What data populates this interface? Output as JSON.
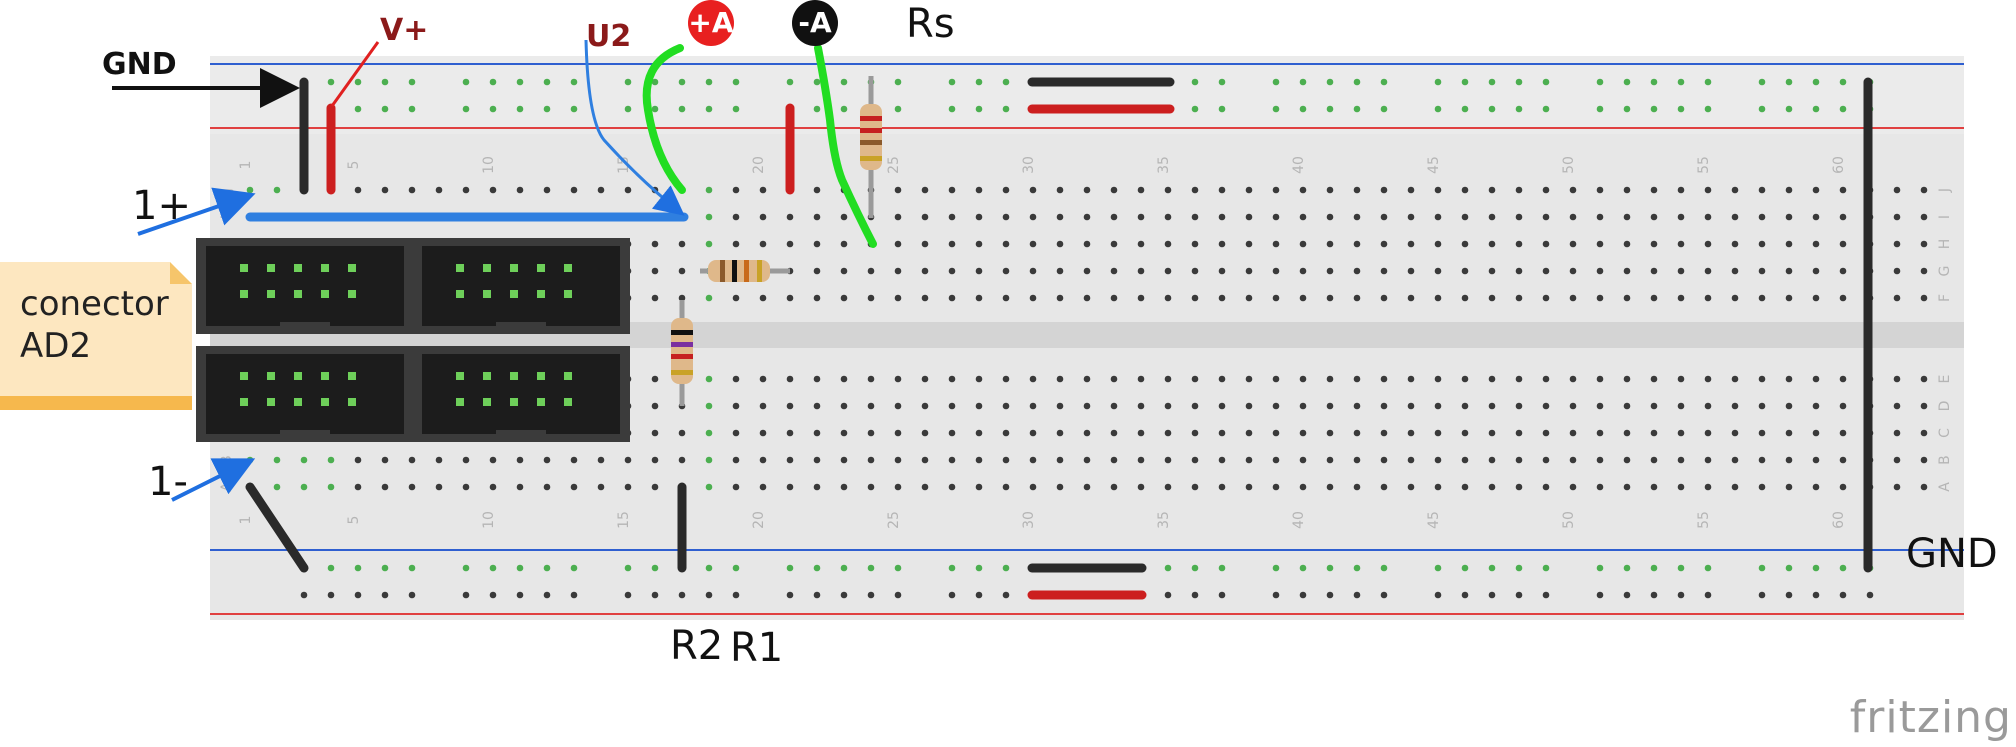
{
  "labels": {
    "gnd_top": "GND",
    "v_plus": "V+",
    "u2": "U2",
    "probe_plus_a": "+A",
    "probe_minus_a": "-A",
    "rs": "Rs",
    "one_plus": "1+",
    "one_minus": "1-",
    "gnd_right": "GND",
    "r2": "R2",
    "r1": "R1"
  },
  "connector_note": {
    "line1": "conector",
    "line2": "AD2"
  },
  "breadboard": {
    "column_numbers": [
      "1",
      "5",
      "10",
      "15",
      "20",
      "25",
      "30",
      "35",
      "40",
      "45",
      "50",
      "55",
      "60"
    ],
    "row_letters_top": [
      "J",
      "I",
      "H",
      "G",
      "F"
    ],
    "row_letters_bottom": [
      "E",
      "D",
      "C",
      "B",
      "A"
    ]
  },
  "colors": {
    "board": "#e9e9e9",
    "rail_blue": "#2f5fd0",
    "rail_red": "#e04040",
    "wire_blue": "#2f7fe0",
    "wire_red": "#d42020",
    "wire_green": "#22dd22",
    "wire_black": "#2a2a2a",
    "probe_red": "#e82020",
    "probe_black": "#111111",
    "dark_red_text": "#8b1a1a"
  },
  "brand": "fritzing"
}
